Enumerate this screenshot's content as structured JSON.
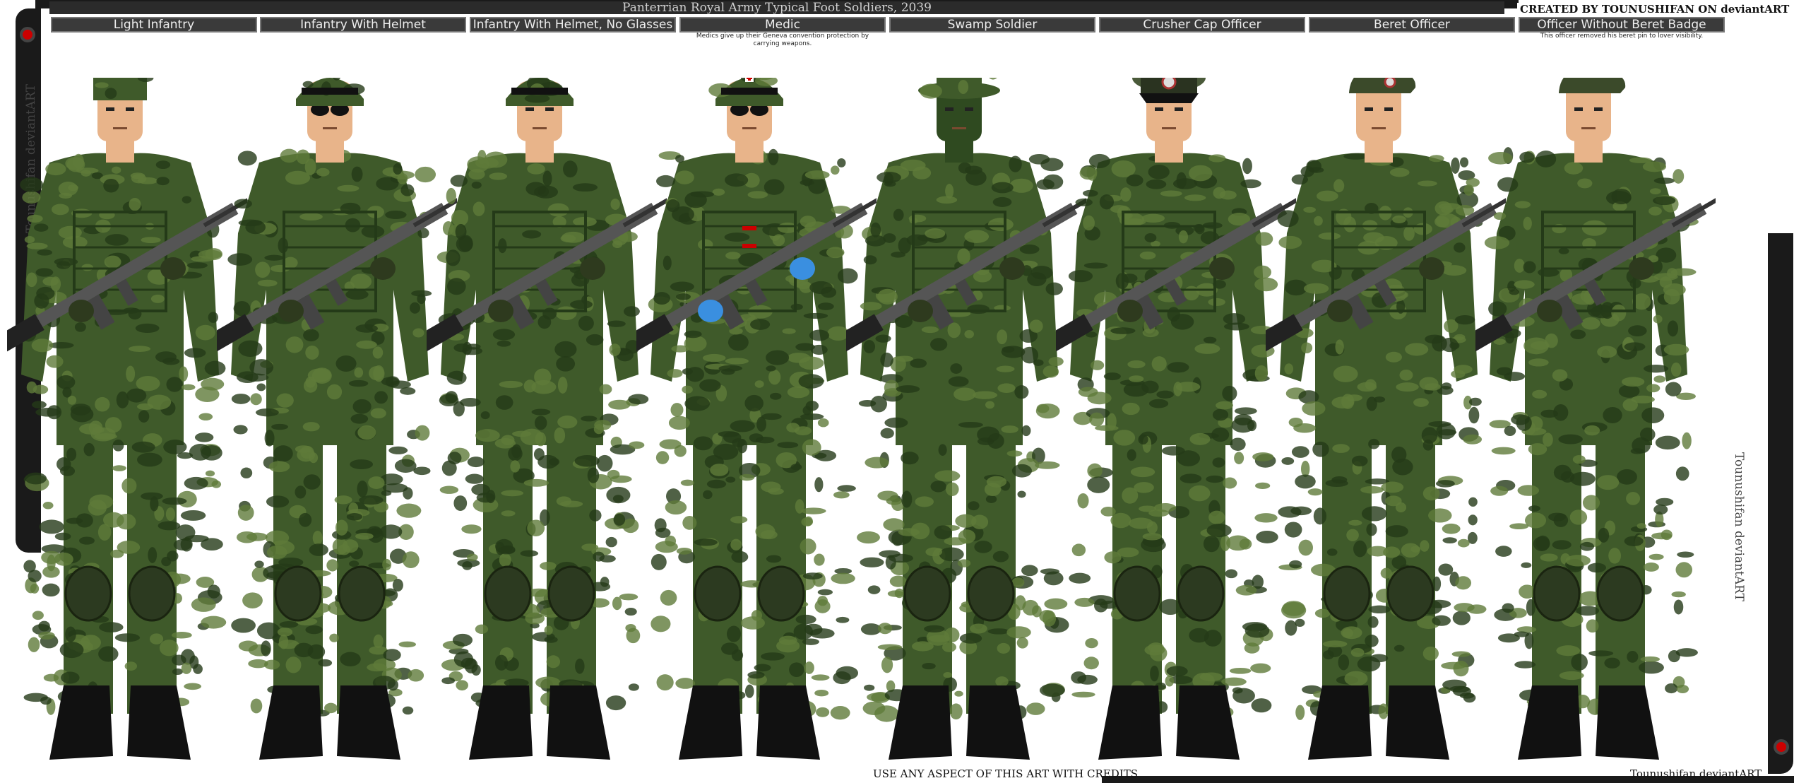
{
  "title": "Panterrian Royal Army Typical Foot Soldiers, 2039",
  "credit": "CREATED BY TOUNUSHIFAN ON deviantART",
  "footer_left": "USE ANY ASPECT OF THIS ART WITH CREDITS",
  "footer_right": "Tounushifan deviantART",
  "side_left": "Tounushifan deviantART",
  "side_right": "Tounushifan deviantART",
  "soldiers": [
    {
      "label": "Light Infantry",
      "note": ""
    },
    {
      "label": "Infantry With Helmet",
      "note": ""
    },
    {
      "label": "Infantry With Helmet, No Glasses",
      "note": ""
    },
    {
      "label": "Medic",
      "note": "Medics give up their Geneva convention protection by carrying weapons."
    },
    {
      "label": "Swamp Soldier",
      "note": ""
    },
    {
      "label": "Crusher Cap Officer",
      "note": ""
    },
    {
      "label": "Beret Officer",
      "note": ""
    },
    {
      "label": "Officer Without Beret Badge",
      "note": "This officer removed his beret pin to lover visibility."
    }
  ],
  "colors": {
    "camo_base": "#3f5a2a",
    "camo_dark": "#243a18",
    "camo_light": "#5f7a3a",
    "skin": "#e8b48a",
    "swamp_face": "#2f4a20",
    "glove_blue": "#3a8fe0",
    "rifle": "#555555",
    "boot": "#111111",
    "frame": "#1a1a1a"
  }
}
